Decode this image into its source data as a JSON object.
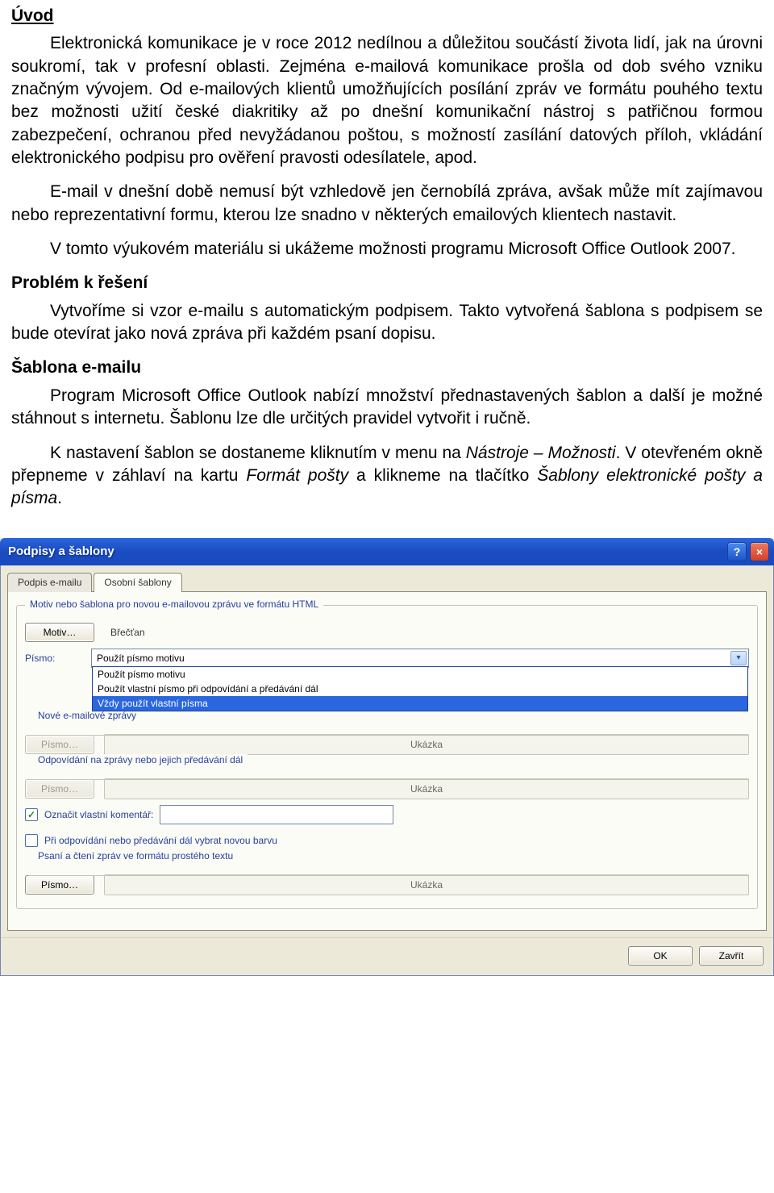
{
  "doc": {
    "h1": "Úvod",
    "p1": "Elektronická komunikace je v roce 2012 nedílnou a důležitou součástí života lidí, jak na úrovni soukromí, tak v profesní oblasti. Zejména e-mailová komunikace prošla od dob svého vzniku značným vývojem. Od e-mailových klientů umožňujících posílání zpráv ve formátu pouhého textu bez možnosti užití české diakritiky až po dnešní komunikační nástroj s patřičnou formou zabezpečení, ochranou před nevyžádanou poštou, s možností zasílání datových příloh, vkládání elektronického podpisu pro ověření pravosti odesílatele, apod.",
    "p2": "E-mail v dnešní době nemusí být vzhledově jen černobílá zpráva, avšak může mít zajímavou nebo reprezentativní formu, kterou lze snadno v některých emailových klientech nastavit.",
    "p3": "V tomto výukovém materiálu si ukážeme možnosti programu Microsoft Office Outlook 2007.",
    "h2": "Problém k řešení",
    "p4": "Vytvoříme si vzor e-mailu s automatickým podpisem. Takto vytvořená šablona s podpisem se bude otevírat jako nová zpráva při každém psaní dopisu.",
    "h3": "Šablona e-mailu",
    "p5": "Program Microsoft Office Outlook nabízí množství přednastavených šablon a další je možné stáhnout s internetu. Šablonu lze dle určitých pravidel vytvořit i ručně.",
    "p6a": "K nastavení šablon se dostaneme kliknutím v menu na ",
    "p6b": "Nástroje – Možnosti",
    "p6c": ". V otevřeném okně přepneme v záhlaví na kartu ",
    "p6d": "Formát pošty",
    "p6e": " a klikneme na tlačítko ",
    "p6f": "Šablony elektronické pošty a písma",
    "p6g": "."
  },
  "dialog": {
    "title": "Podpisy a šablony",
    "help_icon": "?",
    "close_icon": "×",
    "tabs": {
      "0": "Podpis e-mailu",
      "1": "Osobní šablony"
    },
    "active_tab": 1,
    "group1_legend": "Motiv nebo šablona pro novou e-mailovou zprávu ve formátu HTML",
    "motiv_btn": "Motiv…",
    "motiv_value": "Břečťan",
    "font_lbl": "Písmo:",
    "font_select": {
      "value": "Použít písmo motivu",
      "options": {
        "0": "Použít písmo motivu",
        "1": "Použít vlastní písmo při odpovídání a předávání dál",
        "2": "Vždy použít vlastní písma"
      },
      "selected_index": 2
    },
    "section_new": "Nové e-mailové zprávy",
    "section_reply": "Odpovídání na zprávy nebo jejich předávání dál",
    "pismo_btn": "Písmo…",
    "sample_label": "Ukázka",
    "chk_mark_label": "Označit vlastní komentář:",
    "chk_mark_checked": true,
    "chk_color_label": "Při odpovídání nebo předávání dál vybrat novou barvu",
    "chk_color_checked": false,
    "section_plain": "Psaní a čtení zpráv ve formátu prostého textu",
    "footer": {
      "ok": "OK",
      "close": "Zavřít"
    }
  }
}
